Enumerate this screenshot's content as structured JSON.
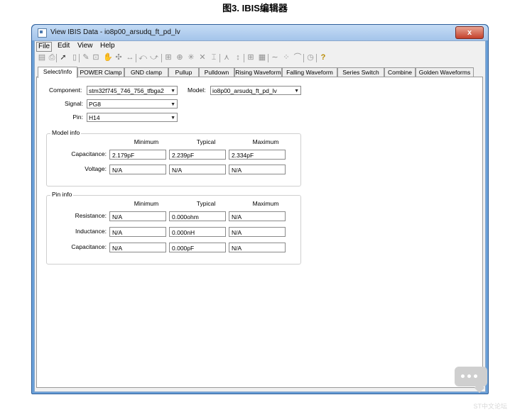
{
  "figure": {
    "caption": "图3. IBIS编辑器"
  },
  "window": {
    "title": "View IBIS Data - io8p00_arsudq_ft_pd_lv",
    "close_glyph": "x"
  },
  "menu": [
    {
      "label": "File"
    },
    {
      "label": "Edit"
    },
    {
      "label": "View"
    },
    {
      "label": "Help"
    }
  ],
  "toolbar": [
    {
      "icon": "save-icon",
      "glyph": "▤"
    },
    {
      "icon": "print-icon",
      "glyph": "⎙"
    },
    {
      "icon": "arrow-pointer-icon",
      "glyph": "➚"
    },
    {
      "icon": "copy-icon",
      "glyph": "▯"
    },
    {
      "icon": "pencil-icon",
      "glyph": "✎"
    },
    {
      "icon": "zoom-box-icon",
      "glyph": "⊡"
    },
    {
      "icon": "pan-hand-icon",
      "glyph": "✋"
    },
    {
      "icon": "crosshair-icon",
      "glyph": "✣"
    },
    {
      "icon": "zoom-horizontal-icon",
      "glyph": "↔"
    },
    {
      "icon": "undo-zoom-icon",
      "glyph": "⤺"
    },
    {
      "icon": "redo-zoom-icon",
      "glyph": "⤻"
    },
    {
      "icon": "fit-icon",
      "glyph": "⊞"
    },
    {
      "icon": "marker-icon",
      "glyph": "⊕"
    },
    {
      "icon": "star-marker-icon",
      "glyph": "✳"
    },
    {
      "icon": "x-marker-icon",
      "glyph": "✕"
    },
    {
      "icon": "cursor-bar-icon",
      "glyph": "⌶"
    },
    {
      "icon": "measure-icon",
      "glyph": "⋏"
    },
    {
      "icon": "vertical-measure-icon",
      "glyph": "↕"
    },
    {
      "icon": "grid-icon",
      "glyph": "⊞"
    },
    {
      "icon": "data-table-icon",
      "glyph": "▦"
    },
    {
      "icon": "curve-icon",
      "glyph": "∼"
    },
    {
      "icon": "scatter-icon",
      "glyph": "⁘"
    },
    {
      "icon": "spline-icon",
      "glyph": "⌒"
    },
    {
      "icon": "clock-icon",
      "glyph": "◷"
    },
    {
      "icon": "help-icon",
      "glyph": "?"
    }
  ],
  "tabs": [
    {
      "label": "Select/Info",
      "active": true
    },
    {
      "label": "POWER Clamp"
    },
    {
      "label": "GND clamp"
    },
    {
      "label": "Pullup"
    },
    {
      "label": "Pulldown"
    },
    {
      "label": "Rising Waveform"
    },
    {
      "label": "Falling Waveform"
    },
    {
      "label": "Series Switch"
    },
    {
      "label": "Combine"
    },
    {
      "label": "Golden Waveforms"
    }
  ],
  "selectors": {
    "component": {
      "label": "Component:",
      "value": "stm32f745_746_756_tfbga2"
    },
    "model": {
      "label": "Model:",
      "value": "io8p00_arsudq_ft_pd_lv"
    },
    "signal": {
      "label": "Signal:",
      "value": "PG8"
    },
    "pin": {
      "label": "Pin:",
      "value": "H14"
    }
  },
  "columns": {
    "min": "Minimum",
    "typ": "Typical",
    "max": "Maximum"
  },
  "model_info": {
    "title": "Model info",
    "rows": [
      {
        "label": "Capacitance:",
        "min": "2.179pF",
        "typ": "2.239pF",
        "max": "2.334pF"
      },
      {
        "label": "Voltage:",
        "min": "N/A",
        "typ": "N/A",
        "max": "N/A"
      }
    ]
  },
  "pin_info": {
    "title": "Pin info",
    "rows": [
      {
        "label": "Resistance:",
        "min": "N/A",
        "typ": "0.000ohm",
        "max": "N/A"
      },
      {
        "label": "Inductance:",
        "min": "N/A",
        "typ": "0.000nH",
        "max": "N/A"
      },
      {
        "label": "Capacitance:",
        "min": "N/A",
        "typ": "0.000pF",
        "max": "N/A"
      }
    ]
  },
  "watermark": "ST中文论坛"
}
